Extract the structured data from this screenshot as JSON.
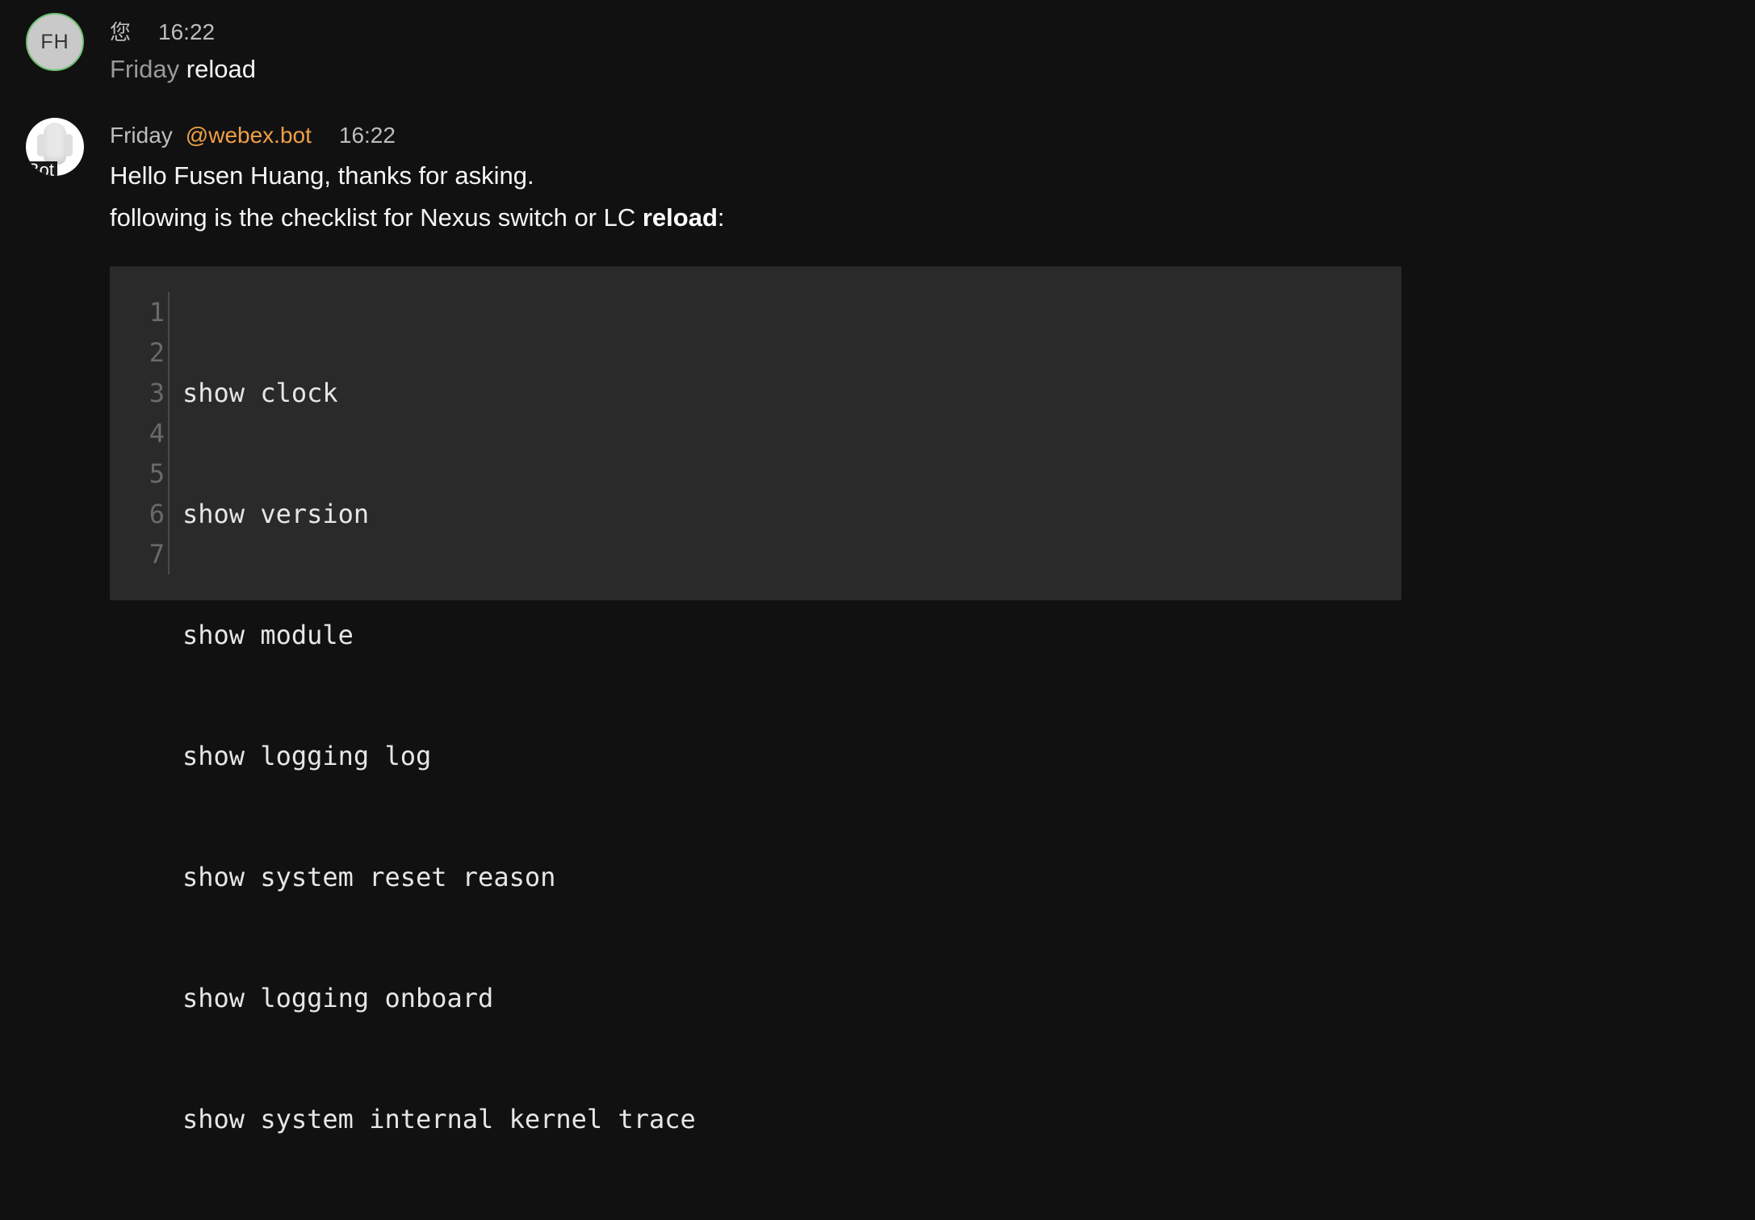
{
  "messages": [
    {
      "avatar_initials": "FH",
      "sender": "您",
      "time": "16:22",
      "text_prefix": "Friday",
      "text_body": "reload"
    },
    {
      "avatar_label": "Bot",
      "sender": "Friday",
      "mention": "@webex.bot",
      "time": "16:22",
      "greeting": "Hello Fusen Huang, thanks for asking.",
      "intro_text": "following is the checklist for Nexus switch or LC ",
      "intro_bold": "reload",
      "intro_suffix": ":",
      "code": {
        "line_numbers": [
          "1",
          "2",
          "3",
          "4",
          "5",
          "6",
          "7"
        ],
        "lines": [
          "show clock",
          "show version",
          "show module",
          "show logging log",
          "show system reset reason",
          "show logging onboard",
          "show system internal kernel trace"
        ]
      }
    }
  ],
  "colors": {
    "background": "#111111",
    "mention": "#f0a046",
    "code_background": "#2a2a2a",
    "avatar_ring": "#6fbf73"
  }
}
